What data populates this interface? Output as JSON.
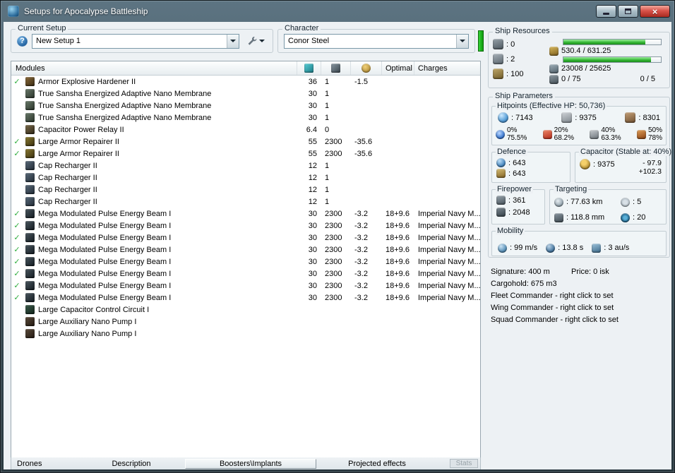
{
  "window": {
    "title": "Setups for Apocalypse Battleship"
  },
  "glyphs": {
    "help": "?",
    "check": "✓",
    "close": "×"
  },
  "setup": {
    "group_label": "Current Setup",
    "value": "New Setup 1"
  },
  "character": {
    "group_label": "Character",
    "value": "Conor Steel"
  },
  "modules_table": {
    "title": "Modules",
    "col_optimal": "Optimal",
    "col_charges": "Charges",
    "rows": [
      {
        "active": true,
        "type": "hardener",
        "name": "Armor Explosive Hardener II",
        "cpu": "36",
        "pg": "1",
        "cap": "-1.5",
        "optimal": "",
        "charges": ""
      },
      {
        "active": false,
        "type": "membrane",
        "name": "True Sansha Energized Adaptive Nano Membrane",
        "cpu": "30",
        "pg": "1",
        "cap": "",
        "optimal": "",
        "charges": ""
      },
      {
        "active": false,
        "type": "membrane",
        "name": "True Sansha Energized Adaptive Nano Membrane",
        "cpu": "30",
        "pg": "1",
        "cap": "",
        "optimal": "",
        "charges": ""
      },
      {
        "active": false,
        "type": "membrane",
        "name": "True Sansha Energized Adaptive Nano Membrane",
        "cpu": "30",
        "pg": "1",
        "cap": "",
        "optimal": "",
        "charges": ""
      },
      {
        "active": false,
        "type": "relay",
        "name": "Capacitor Power Relay II",
        "cpu": "6.4",
        "pg": "0",
        "cap": "",
        "optimal": "",
        "charges": ""
      },
      {
        "active": true,
        "type": "repairer",
        "name": "Large Armor Repairer II",
        "cpu": "55",
        "pg": "2300",
        "cap": "-35.6",
        "optimal": "",
        "charges": ""
      },
      {
        "active": true,
        "type": "repairer",
        "name": "Large Armor Repairer II",
        "cpu": "55",
        "pg": "2300",
        "cap": "-35.6",
        "optimal": "",
        "charges": ""
      },
      {
        "active": false,
        "type": "recharger",
        "name": "Cap Recharger II",
        "cpu": "12",
        "pg": "1",
        "cap": "",
        "optimal": "",
        "charges": ""
      },
      {
        "active": false,
        "type": "recharger",
        "name": "Cap Recharger II",
        "cpu": "12",
        "pg": "1",
        "cap": "",
        "optimal": "",
        "charges": ""
      },
      {
        "active": false,
        "type": "recharger",
        "name": "Cap Recharger II",
        "cpu": "12",
        "pg": "1",
        "cap": "",
        "optimal": "",
        "charges": ""
      },
      {
        "active": false,
        "type": "recharger",
        "name": "Cap Recharger II",
        "cpu": "12",
        "pg": "1",
        "cap": "",
        "optimal": "",
        "charges": ""
      },
      {
        "active": true,
        "type": "beam",
        "name": "Mega Modulated Pulse Energy Beam I",
        "cpu": "30",
        "pg": "2300",
        "cap": "-3.2",
        "optimal": "18+9.6",
        "charges": "Imperial Navy M..."
      },
      {
        "active": true,
        "type": "beam",
        "name": "Mega Modulated Pulse Energy Beam I",
        "cpu": "30",
        "pg": "2300",
        "cap": "-3.2",
        "optimal": "18+9.6",
        "charges": "Imperial Navy M..."
      },
      {
        "active": true,
        "type": "beam",
        "name": "Mega Modulated Pulse Energy Beam I",
        "cpu": "30",
        "pg": "2300",
        "cap": "-3.2",
        "optimal": "18+9.6",
        "charges": "Imperial Navy M..."
      },
      {
        "active": true,
        "type": "beam",
        "name": "Mega Modulated Pulse Energy Beam I",
        "cpu": "30",
        "pg": "2300",
        "cap": "-3.2",
        "optimal": "18+9.6",
        "charges": "Imperial Navy M..."
      },
      {
        "active": true,
        "type": "beam",
        "name": "Mega Modulated Pulse Energy Beam I",
        "cpu": "30",
        "pg": "2300",
        "cap": "-3.2",
        "optimal": "18+9.6",
        "charges": "Imperial Navy M..."
      },
      {
        "active": true,
        "type": "beam",
        "name": "Mega Modulated Pulse Energy Beam I",
        "cpu": "30",
        "pg": "2300",
        "cap": "-3.2",
        "optimal": "18+9.6",
        "charges": "Imperial Navy M..."
      },
      {
        "active": true,
        "type": "beam",
        "name": "Mega Modulated Pulse Energy Beam I",
        "cpu": "30",
        "pg": "2300",
        "cap": "-3.2",
        "optimal": "18+9.6",
        "charges": "Imperial Navy M..."
      },
      {
        "active": true,
        "type": "beam",
        "name": "Mega Modulated Pulse Energy Beam I",
        "cpu": "30",
        "pg": "2300",
        "cap": "-3.2",
        "optimal": "18+9.6",
        "charges": "Imperial Navy M..."
      },
      {
        "active": false,
        "type": "rig-circuit",
        "name": "Large Capacitor Control Circuit I",
        "cpu": "",
        "pg": "",
        "cap": "",
        "optimal": "",
        "charges": ""
      },
      {
        "active": false,
        "type": "rig-pump",
        "name": "Large Auxiliary Nano Pump I",
        "cpu": "",
        "pg": "",
        "cap": "",
        "optimal": "",
        "charges": ""
      },
      {
        "active": false,
        "type": "rig-pump",
        "name": "Large Auxiliary Nano Pump I",
        "cpu": "",
        "pg": "",
        "cap": "",
        "optimal": "",
        "charges": ""
      }
    ]
  },
  "bottom_tabs": {
    "drones": "Drones",
    "description": "Description",
    "boosters": "Boosters\\Implants",
    "projected": "Projected effects",
    "stats": "Stats"
  },
  "ship_resources": {
    "label": "Ship Resources",
    "turrets": ": 0",
    "launchers": ": 2",
    "calibration": ": 100",
    "cpu_text": "530.4 / 631.25",
    "cpu_percent": 84,
    "powergrid_text": "23008 / 25625",
    "powergrid_percent": 90,
    "dronebay_text": "0 / 75",
    "drones_text": "0 / 5"
  },
  "ship_parameters": {
    "label": "Ship Parameters",
    "hitpoints": {
      "label": "Hitpoints (Effective HP: 50,736)",
      "shield": ": 7143",
      "armor": ": 9375",
      "hull": ": 8301",
      "resists": [
        {
          "name": "em",
          "shield": "0%",
          "armor": "75.5%"
        },
        {
          "name": "thermal",
          "shield": "20%",
          "armor": "68.2%"
        },
        {
          "name": "kinetic",
          "shield": "40%",
          "armor": "63.3%"
        },
        {
          "name": "explosive",
          "shield": "50%",
          "armor": "78%"
        }
      ]
    },
    "defence": {
      "label": "Defence",
      "value1": ": 643",
      "value2": ": 643"
    },
    "capacitor": {
      "label": "Capacitor (Stable at: 40%)",
      "amount": ": 9375",
      "drain": "- 97.9",
      "recharge": "+102.3"
    },
    "firepower": {
      "label": "Firepower",
      "dps": ": 361",
      "volley": ": 2048"
    },
    "targeting": {
      "label": "Targeting",
      "range": ": 77.63 km",
      "max_targets": ": 5",
      "scan_resolution": ": 118.8 mm",
      "sensor_strength": ": 20"
    },
    "mobility": {
      "label": "Mobility",
      "speed": ": 99 m/s",
      "align_time": ": 13.8 s",
      "warp_speed": ": 3 au/s"
    }
  },
  "ship_info": {
    "signature": "Signature: 400 m",
    "price": "Price: 0 isk",
    "cargohold": "Cargohold: 675 m3",
    "fleet_commander": "Fleet Commander - right click to set",
    "wing_commander": "Wing Commander - right click to set",
    "squad_commander": "Squad Commander - right click to set"
  }
}
